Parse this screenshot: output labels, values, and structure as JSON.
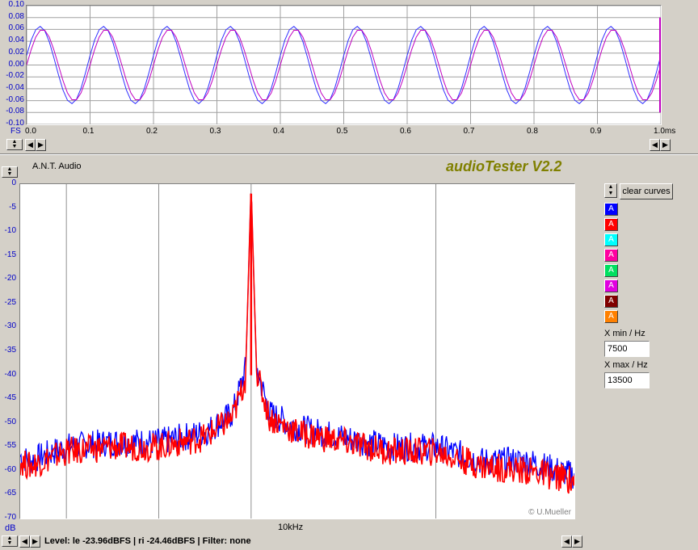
{
  "scope": {
    "y_ticks": [
      "0.10",
      "0.08",
      "0.06",
      "0.04",
      "0.02",
      "0.00",
      "-0.02",
      "-0.04",
      "-0.06",
      "-0.08",
      "-0.10"
    ],
    "x_ticks": [
      "0.0",
      "0.1",
      "0.2",
      "0.3",
      "0.4",
      "0.5",
      "0.6",
      "0.7",
      "0.8",
      "0.9",
      "1.0ms"
    ],
    "fs_label": "FS",
    "traces": [
      {
        "color": "#3030ff",
        "amplitude": 0.065,
        "phase_shift": 0.004
      },
      {
        "color": "#c000c0",
        "amplitude": 0.06,
        "phase_shift": 0.0
      }
    ]
  },
  "app": {
    "device_label": "A.N.T. Audio",
    "title": "audioTester V2.2",
    "copyright": "© U.Mueller",
    "title_color": "#808000"
  },
  "controls": {
    "clear_curves_label": "clear curves",
    "curve_buttons": [
      {
        "label": "A",
        "color": "#0000ff"
      },
      {
        "label": "A",
        "color": "#ff0000"
      },
      {
        "label": "A",
        "color": "#00ffff"
      },
      {
        "label": "A",
        "color": "#ff00a0"
      },
      {
        "label": "A",
        "color": "#00e060"
      },
      {
        "label": "A",
        "color": "#e000e0"
      },
      {
        "label": "A",
        "color": "#800000"
      },
      {
        "label": "A",
        "color": "#ff8000"
      }
    ],
    "xmin_label": "X min / Hz",
    "xmin_value": "7500",
    "xmax_label": "X max / Hz",
    "xmax_value": "13500"
  },
  "spectrum": {
    "y_ticks": [
      "0",
      "-5",
      "-10",
      "-15",
      "-20",
      "-25",
      "-30",
      "-35",
      "-40",
      "-45",
      "-50",
      "-55",
      "-60",
      "-65",
      "-70"
    ],
    "x_label": "10kHz",
    "y_unit": "dB"
  },
  "status": {
    "text": "Level: le -23.96dBFS  |  ri -24.46dBFS  |  Filter: none"
  },
  "chart_data": [
    {
      "type": "line",
      "title": "",
      "xlabel": "ms",
      "ylabel": "",
      "xlim": [
        0.0,
        1.0
      ],
      "ylim": [
        -0.1,
        0.1
      ],
      "frequency_khz": 10,
      "series": [
        {
          "color": "#3030ff",
          "amplitude": 0.065
        },
        {
          "color": "#c000c0",
          "amplitude": 0.06
        }
      ],
      "grid": true
    },
    {
      "type": "line",
      "title": "",
      "xlabel": "10kHz",
      "ylabel": "dB",
      "xlim": [
        7500,
        13500
      ],
      "ylim": [
        -70,
        0
      ],
      "peak": {
        "x": 10000,
        "y": 0
      },
      "series": [
        {
          "color": "#0000ff",
          "x": [
            7500,
            7600,
            8000,
            8500,
            9000,
            9500,
            9800,
            9950,
            10000,
            10050,
            10200,
            10500,
            11000,
            11500,
            12000,
            12500,
            13000,
            13500
          ],
          "y": [
            -57,
            -58,
            -55,
            -54,
            -54,
            -52,
            -48,
            -38,
            0,
            -38,
            -48,
            -51,
            -53,
            -55,
            -55,
            -58,
            -58,
            -61
          ]
        },
        {
          "color": "#ff0000",
          "x": [
            7500,
            7600,
            8000,
            8500,
            9000,
            9500,
            9800,
            9950,
            10000,
            10050,
            10200,
            10500,
            11000,
            11500,
            12000,
            12500,
            13000,
            13500
          ],
          "y": [
            -58,
            -59,
            -56,
            -55,
            -55,
            -53,
            -49,
            -40,
            0,
            -39,
            -49,
            -52,
            -54,
            -56,
            -56,
            -59,
            -60,
            -62
          ]
        }
      ],
      "grid": true
    }
  ]
}
